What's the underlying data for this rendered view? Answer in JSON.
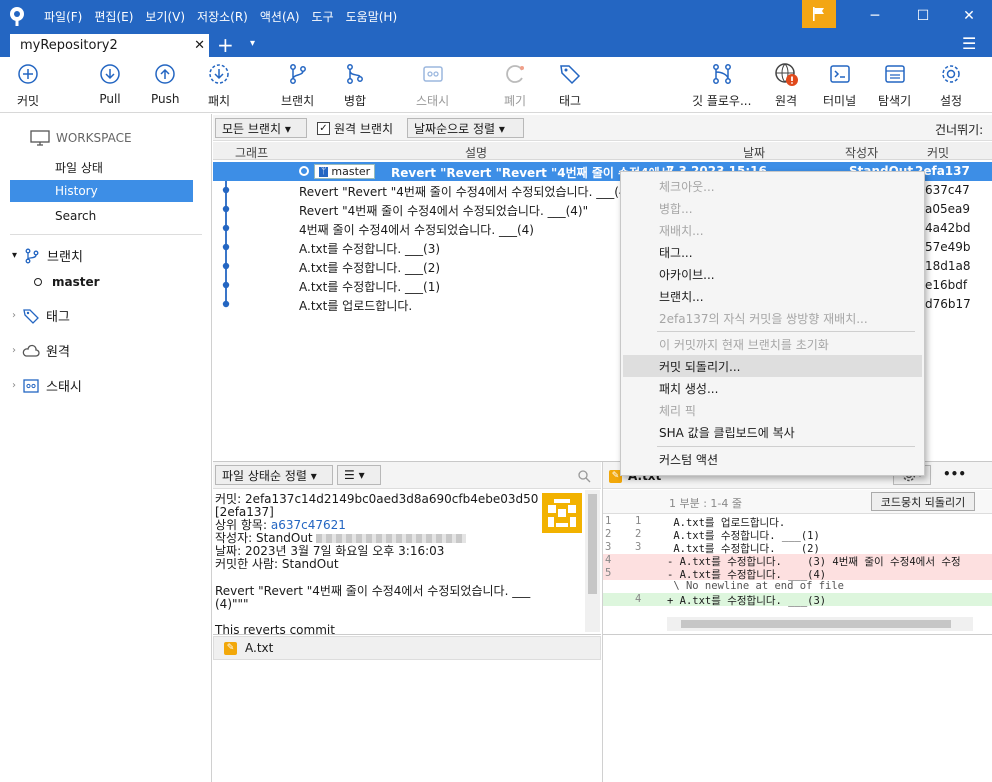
{
  "menu": [
    "파일(F)",
    "편집(E)",
    "보기(V)",
    "저장소(R)",
    "액션(A)",
    "도구",
    "도움말(H)"
  ],
  "window": {
    "minimize": "─",
    "maximize": "☐",
    "close": "✕"
  },
  "tab": {
    "title": "myRepository2",
    "close": "✕",
    "add": "+",
    "dropdown": "▾",
    "hamburger": "☰"
  },
  "toolbar": {
    "commit": "커밋",
    "pull": "Pull",
    "push": "Push",
    "fetch": "패치",
    "branch": "브랜치",
    "merge": "병합",
    "stash": "스태시",
    "discard": "폐기",
    "tag": "태그",
    "gitflow": "깃 플로우...",
    "remote": "원격",
    "terminal": "터미널",
    "explorer": "탐색기",
    "settings": "설정"
  },
  "sidebar": {
    "workspace": "WORKSPACE",
    "file_status": "파일 상태",
    "history": "History",
    "search": "Search",
    "branches": "브랜치",
    "master": "master",
    "tags": "태그",
    "remotes": "원격",
    "stashes": "스태시"
  },
  "filter": {
    "branches": "모든 브랜치 ▾",
    "remote_branches": "원격 브랜치",
    "sort": "날짜순으로 정렬 ▾",
    "jump": "건너뛰기:"
  },
  "columns": {
    "graph": "그래프",
    "description": "설명",
    "date": "날짜",
    "author": "작성자",
    "commit": "커밋"
  },
  "commits": [
    {
      "branch": "master",
      "msg": "Revert \"Revert \"Revert \"4번째 줄이 수정4에서",
      "date": "7 3 2023 15:16",
      "author": "StandOut",
      "hash": "2efa137"
    },
    {
      "msg": "Revert \"Revert \"4번째 줄이 수정4에서 수정되었습니다. ___(4",
      "hash": "637c47"
    },
    {
      "msg": "Revert \"4번째 줄이 수정4에서 수정되었습니다. ___(4)\"",
      "hash": "a05ea9"
    },
    {
      "msg": "4번째 줄이 수정4에서 수정되었습니다. ___(4)",
      "hash": "4a42bd"
    },
    {
      "msg": "A.txt를 수정합니다. ___(3)",
      "hash": "57e49b"
    },
    {
      "msg": "A.txt를 수정합니다. ___(2)",
      "hash": "18d1a8"
    },
    {
      "msg": "A.txt를 수정합니다. ___(1)",
      "hash": "e16bdf"
    },
    {
      "msg": "A.txt를 업로드합니다.",
      "hash": "d76b17"
    }
  ],
  "context_menu": [
    {
      "label": "체크아웃...",
      "enabled": false
    },
    {
      "label": "병합...",
      "enabled": false
    },
    {
      "label": "재배치...",
      "enabled": false
    },
    {
      "label": "태그...",
      "enabled": true
    },
    {
      "label": "아카이브...",
      "enabled": true
    },
    {
      "label": "브랜치...",
      "enabled": true
    },
    {
      "label": "2efa137의 자식 커밋을 쌍방향 재배치...",
      "enabled": false
    },
    {
      "label": "이 커밋까지 현재 브랜치를 초기화",
      "enabled": false
    },
    {
      "label": "커밋 되돌리기...",
      "enabled": true
    },
    {
      "label": "패치 생성...",
      "enabled": true
    },
    {
      "label": "체리 픽",
      "enabled": false
    },
    {
      "label": "SHA 값을 클립보드에 복사",
      "enabled": true
    },
    {
      "label": "커스텀 액션",
      "enabled": true
    }
  ],
  "details": {
    "sort": "파일 상태순 정렬 ▾",
    "view": "☰ ▾",
    "commit_line": "커밋: 2efa137c14d2149bc0aed3d8a690cfb4ebe03d50",
    "short": "[2efa137]",
    "parent_label": "상위 항목:",
    "parent": "a637c47621",
    "author": "작성자: StandOut",
    "date": "날짜: 2023년 3월 7일 화요일 오후 3:16:03",
    "committer": "커밋한 사람: StandOut",
    "message1": "Revert \"Revert \"4번째 줄이 수정4에서 수정되었습니다. ___",
    "message2": "(4)\"\"\"",
    "message3": "This reverts commit",
    "file": "A.txt"
  },
  "diff": {
    "file": "A.txt",
    "hunk": "1 부분 : 1-4 줄",
    "discard": "코드뭉치 되돌리기",
    "more": "•••",
    "lines": [
      {
        "o": "1",
        "n": "1",
        "t": " A.txt를 업로드합니다.",
        "k": "ctx"
      },
      {
        "o": "2",
        "n": "2",
        "t": " A.txt를 수정합니다. ___(1)",
        "k": "ctx"
      },
      {
        "o": "3",
        "n": "3",
        "t": " A.txt를 수정합니다. ___(2)",
        "k": "ctx"
      },
      {
        "o": "4",
        "n": "",
        "t": "- A.txt를 수정합니다. ___(3) 4번째 줄이 수정4에서 수정",
        "k": "del"
      },
      {
        "o": "5",
        "n": "",
        "t": "- A.txt를 수정합니다. ___(4)",
        "k": "del"
      },
      {
        "o": "",
        "n": "",
        "t": " \\ No newline at end of file",
        "k": "ctx"
      },
      {
        "o": "",
        "n": "4",
        "t": "+ A.txt를 수정합니다. ___(3)",
        "k": "add"
      }
    ]
  }
}
